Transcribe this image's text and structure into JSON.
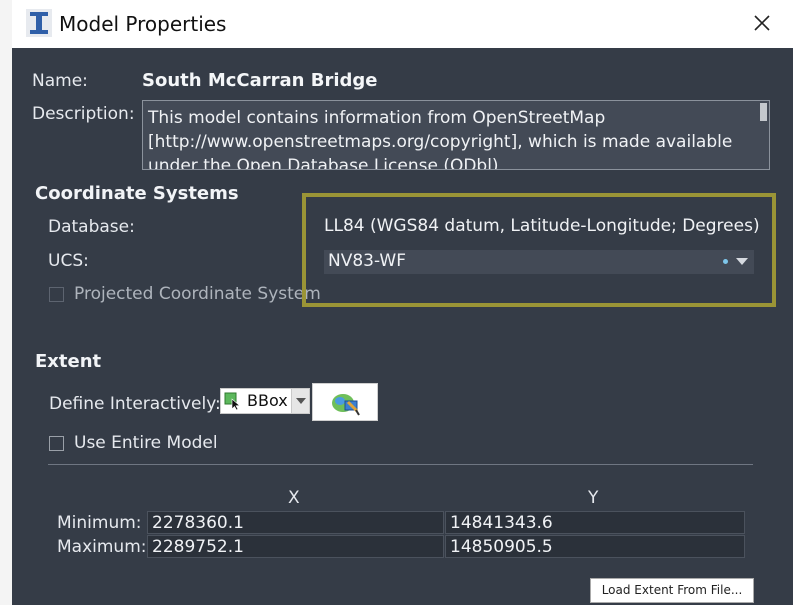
{
  "window": {
    "title": "Model Properties",
    "app_icon": "i-beam-icon",
    "close_icon": "close-icon"
  },
  "model": {
    "name_label": "Name:",
    "name_value": "South McCarran Bridge",
    "description_label": "Description:",
    "description_value": "This model contains information from OpenStreetMap [http://www.openstreetmaps.org/copyright], which is made available under the Open Database License (ODbl) [http://opendatacommons.org/"
  },
  "coordinate_systems": {
    "heading": "Coordinate Systems",
    "database_label": "Database:",
    "database_value": "LL84 (WGS84 datum, Latitude-Longitude; Degrees)",
    "ucs_label": "UCS:",
    "ucs_value": "NV83-WF",
    "projected_label": "Projected Coordinate System",
    "projected_checked": false,
    "highlight_color": "#9a9436"
  },
  "extent": {
    "heading": "Extent",
    "define_label": "Define Interactively:",
    "bbox_value": "BBox",
    "use_entire_label": "Use Entire Model",
    "use_entire_checked": false,
    "col_x": "X",
    "col_y": "Y",
    "rows": [
      {
        "label": "Minimum:",
        "x": "2278360.1",
        "y": "14841343.6"
      },
      {
        "label": "Maximum:",
        "x": "2289752.1",
        "y": "14850905.5"
      }
    ],
    "load_button": "Load Extent From File..."
  },
  "colors": {
    "panel_bg": "#353c47",
    "field_bg": "#434a56"
  }
}
